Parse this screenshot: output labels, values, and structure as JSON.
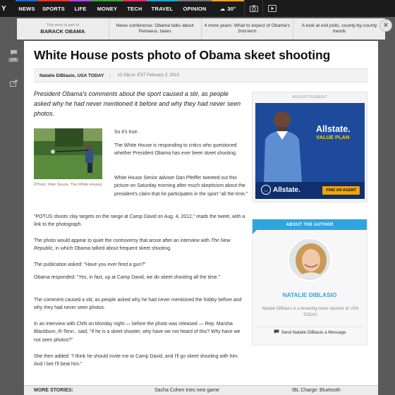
{
  "nav": {
    "logo": "Y",
    "items": [
      "NEWS",
      "SPORTS",
      "LIFE",
      "MONEY",
      "TECH",
      "TRAVEL",
      "OPINION"
    ],
    "weather": "30°",
    "icons": [
      "cloud-icon",
      "camera-icon",
      "video-icon"
    ]
  },
  "teasers": [
    {
      "small": "This story is part of",
      "big": "BARACK OBAMA"
    },
    {
      "text": "News conference: Obama talks about Petraeus, taxes"
    },
    {
      "text": "4 more years: What to expect of Obama's 2nd-term"
    },
    {
      "text": "A look at exit polls, county-by-county trends"
    }
  ],
  "close_label": "×",
  "tools": {
    "comment_count": "131"
  },
  "article": {
    "headline": "White House posts photo of Obama skeet shooting",
    "byline": "Natalie DiBlasio, USA TODAY",
    "timestamp": "12:16p.m. EST February 2, 2013",
    "lead": "President Obama's comments about the sport caused a stir, as people asked why he had never mentioned it before and why they had never seen photos.",
    "photo_caption": "(Photo: Pete Souza, The White House)",
    "p1": "So it's true.",
    "p2": "The White House is responding to critics who questioned whether President Obama has ever been skeet shooting.",
    "p3": "White House Senior adviser Dan Pfeiffer tweeted out this picture on Saturday morning after much skepticism about the president's claim that he participates in the sport \"all the time.\"",
    "p4": "\"POTUS shoots clay targets on the range at Camp David on Aug. 4, 2012,\" reads the tweet, with a link to the photograph.",
    "p5_a": "The photo would appear to quiet the controversy that arose after an interview with ",
    "p5_i": "The New Republic",
    "p5_b": ", in which Obama talked about frequent skeet shooting.",
    "p6": "The publication asked: \"Have you ever fired a gun?\"",
    "p7": "Obama responded: \"Yes, in fact, up at Camp David, we do skeet shooting all the time.\"",
    "p8": "The comment caused a stir, as people asked why he had never mentioned the hobby before and why they had never seen photos.",
    "p9": "In an interview with CNN on Monday night — before the photo was released — Rep. Marsha Blackburn, R-Tenn., said, \"If he is a skeet shooter, why have we not heard of this? Why have we not seen photos?\"",
    "p10": "She then added: \"I think he should invite me to Camp David, and I'll go skeet shooting with him. And I bet I'll beat him.\""
  },
  "ad": {
    "label": "ADVERTISEMENT",
    "brand": "Allstate.",
    "plan": "VALUE PLAN",
    "logo_text": "Allstate.",
    "cta": "FIND AN AGENT"
  },
  "author": {
    "header": "ABOUT THE AUTHOR",
    "name": "NATALIE DIBLASIO",
    "bio": "Natalie DiBlasio is a breaking news reporter at USA TODAY.",
    "send": "Send Natalie DiBlasio a Message"
  },
  "bottom": {
    "more": "MORE STORIES:",
    "story1": "Sacha Cohen tries new game",
    "story2": "IBL Charge: Bluetooth"
  },
  "colors": {
    "accent": "#2fa5df",
    "ad_blue": "#1e4a9c",
    "ad_yellow": "#f2a400"
  }
}
